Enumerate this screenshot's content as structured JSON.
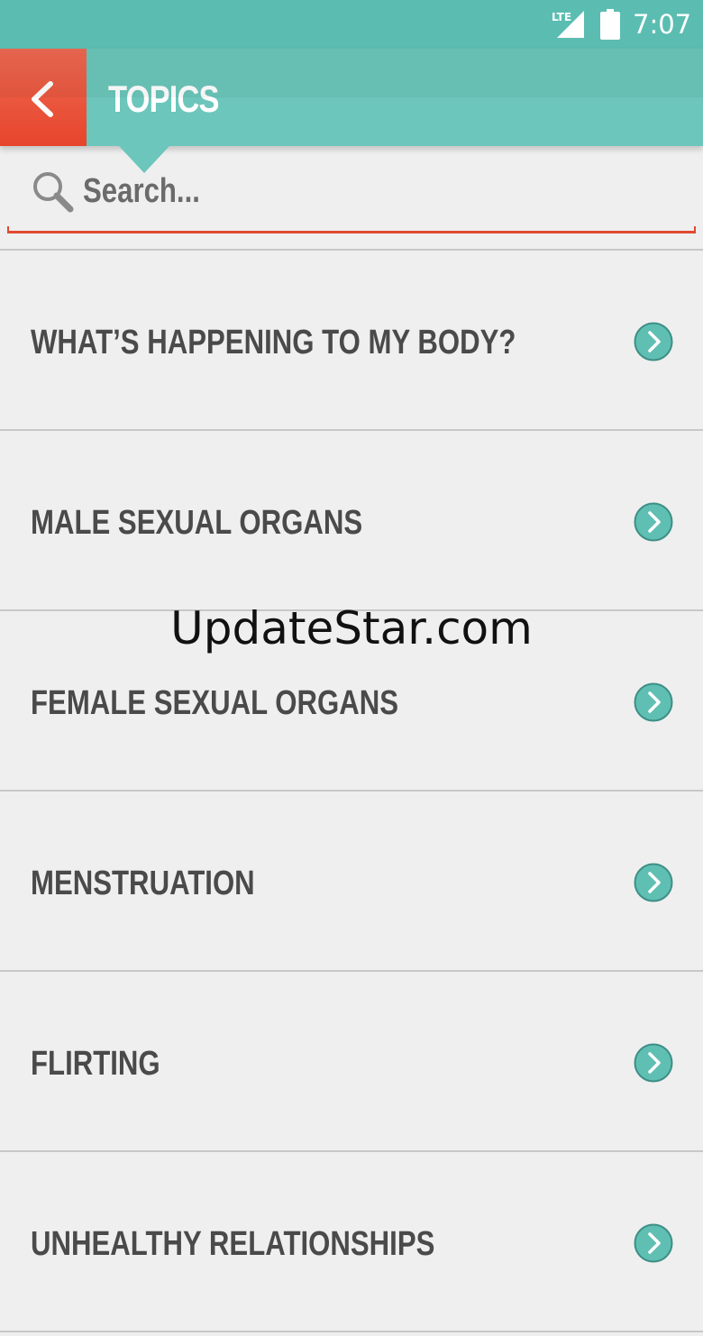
{
  "status_bar": {
    "network_label": "LTE",
    "time": "7:07",
    "icons": [
      "lte-signal-icon",
      "battery-icon"
    ]
  },
  "app_bar": {
    "title": "TOPICS",
    "back_icon": "chevron-left-icon"
  },
  "search": {
    "placeholder": "Search...",
    "value": "",
    "icon": "search-icon"
  },
  "topics": [
    {
      "label": "WHAT’S HAPPENING TO MY BODY?"
    },
    {
      "label": "MALE SEXUAL ORGANS"
    },
    {
      "label": "FEMALE SEXUAL ORGANS"
    },
    {
      "label": "MENSTRUATION"
    },
    {
      "label": "FLIRTING"
    },
    {
      "label": "UNHEALTHY RELATIONSHIPS"
    }
  ],
  "watermark": "UpdateStar.com",
  "colors": {
    "teal": "#6cc6bb",
    "status_teal": "#5bbdb1",
    "accent_red": "#e6452c",
    "text_dark": "#4a4a4a",
    "background": "#efefef"
  }
}
